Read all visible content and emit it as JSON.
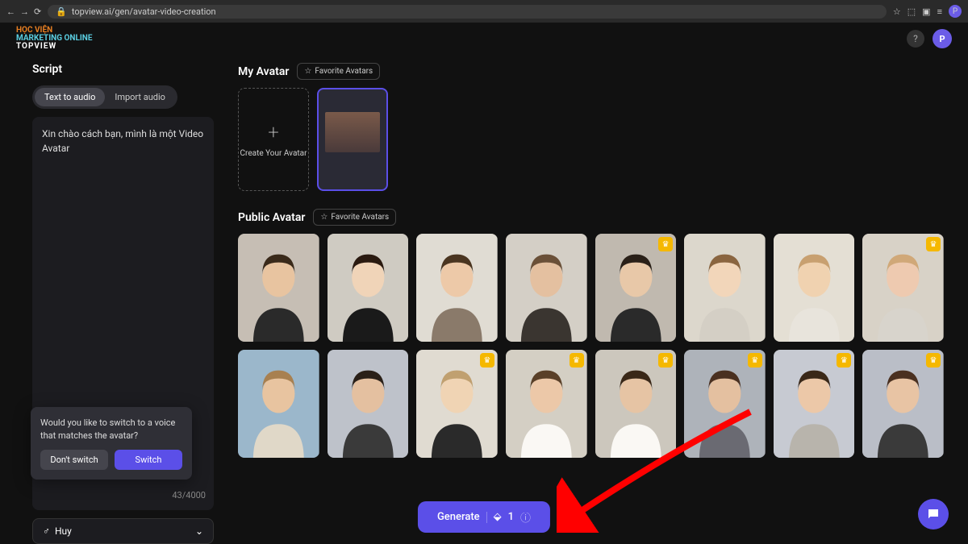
{
  "browser": {
    "url": "topview.ai/gen/avatar-video-creation",
    "profile_initial": "P"
  },
  "logo": {
    "line1": "HỌC VIỆN",
    "line2": "MARKETING ONLINE",
    "line3": "TOPVIEW"
  },
  "header": {
    "help": "?",
    "profile_initial": "P"
  },
  "sidebar": {
    "title": "Script",
    "tabs": {
      "text_to_audio": "Text to audio",
      "import_audio": "Import audio"
    },
    "script_text": "Xin chào cách bạn, mình là một Video Avatar",
    "char_count": "43/4000",
    "voice_selected": "Huy"
  },
  "popup": {
    "message": "Would you like to switch to a voice that matches the avatar?",
    "dont_switch": "Don't switch",
    "switch": "Switch"
  },
  "content": {
    "my_avatar_title": "My Avatar",
    "public_avatar_title": "Public Avatar",
    "favorite_label": "Favorite Avatars",
    "create_label": "Create Your Avatar",
    "public_avatars": [
      {
        "crown": false
      },
      {
        "crown": false
      },
      {
        "crown": false
      },
      {
        "crown": false
      },
      {
        "crown": true
      },
      {
        "crown": false
      },
      {
        "crown": false
      },
      {
        "crown": true
      },
      {
        "crown": false
      },
      {
        "crown": false
      },
      {
        "crown": true
      },
      {
        "crown": true
      },
      {
        "crown": true
      },
      {
        "crown": true
      },
      {
        "crown": true
      },
      {
        "crown": true
      }
    ]
  },
  "generate": {
    "label": "Generate",
    "credits": "1"
  }
}
